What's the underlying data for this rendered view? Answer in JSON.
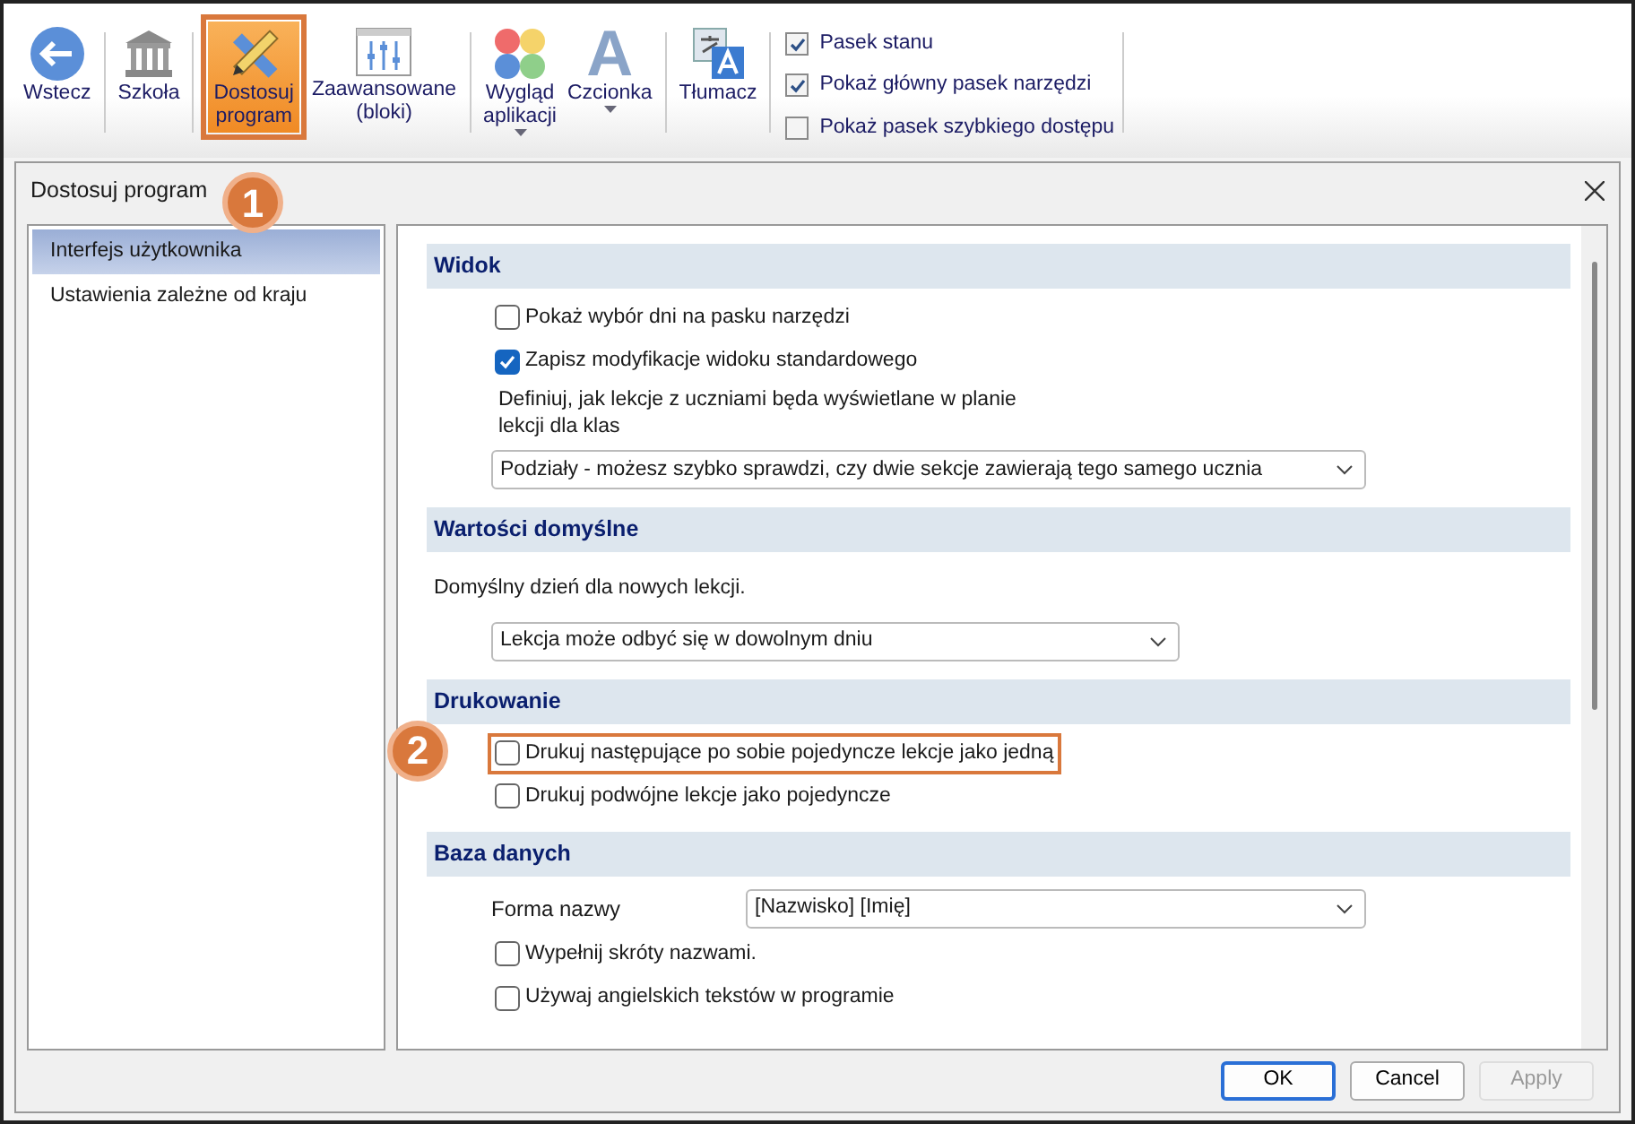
{
  "ribbon": {
    "buttons": [
      {
        "label": "Wstecz",
        "selected": false,
        "dropdown": false
      },
      {
        "label": "Szkoła",
        "selected": false,
        "dropdown": false
      },
      {
        "label": "Dostosuj program",
        "selected": true,
        "dropdown": false,
        "callout": "1"
      },
      {
        "label": "Zaawansowane (bloki)",
        "selected": false,
        "dropdown": false
      },
      {
        "label": "Wygląd aplikacji",
        "selected": false,
        "dropdown": true
      },
      {
        "label": "Czcionka",
        "glyph": "A",
        "selected": false,
        "dropdown": true
      },
      {
        "label": "Tłumacz",
        "selected": false,
        "dropdown": false
      }
    ],
    "checkboxes": [
      {
        "label": "Pasek stanu",
        "checked": true
      },
      {
        "label": "Pokaż główny pasek narzędzi",
        "checked": true
      },
      {
        "label": "Pokaż pasek szybkiego dostępu",
        "checked": false
      }
    ]
  },
  "dialog": {
    "title": "Dostosuj program",
    "nav": [
      {
        "label": "Interfejs użytkownika",
        "selected": true
      },
      {
        "label": "Ustawienia zależne od kraju",
        "selected": false
      }
    ],
    "sections": [
      {
        "title": "Widok",
        "items": [
          {
            "kind": "checkbox",
            "label": "Pokaż wybór dni na pasku narzędzi",
            "checked": false
          },
          {
            "kind": "checkbox",
            "label": "Zapisz modyfikacje widoku standardowego",
            "checked": true
          },
          {
            "kind": "text",
            "text": "Definiuj, jak lekcje z uczniami będa wyświetlane w planie lekcji dla klas"
          },
          {
            "kind": "select",
            "value": "Podziały - możesz szybko sprawdzi, czy dwie sekcje zawierają tego samego ucznia"
          }
        ]
      },
      {
        "title": "Wartości domyślne",
        "items": [
          {
            "kind": "label",
            "text": "Domyślny dzień dla nowych lekcji."
          },
          {
            "kind": "select",
            "value": "Lekcja może odbyć się w dowolnym dniu"
          }
        ]
      },
      {
        "title": "Drukowanie",
        "items": [
          {
            "kind": "checkbox",
            "label": "Drukuj następujące po sobie pojedyncze lekcje jako jedną",
            "checked": false,
            "callout": "2"
          },
          {
            "kind": "checkbox",
            "label": "Drukuj podwójne lekcje jako pojedyncze",
            "checked": false
          }
        ]
      },
      {
        "title": "Baza danych",
        "items": [
          {
            "kind": "labeled_select",
            "label": "Forma nazwy",
            "value": "[Nazwisko] [Imię]"
          },
          {
            "kind": "checkbox",
            "label": "Wypełnij skróty nazwami.",
            "checked": false
          },
          {
            "kind": "checkbox",
            "label": "Używaj angielskich tekstów w programie",
            "checked": false
          }
        ]
      }
    ],
    "buttons": [
      {
        "label": "OK",
        "default": true,
        "disabled": false
      },
      {
        "label": "Cancel",
        "default": false,
        "disabled": false
      },
      {
        "label": "Apply",
        "default": false,
        "disabled": true
      }
    ]
  }
}
